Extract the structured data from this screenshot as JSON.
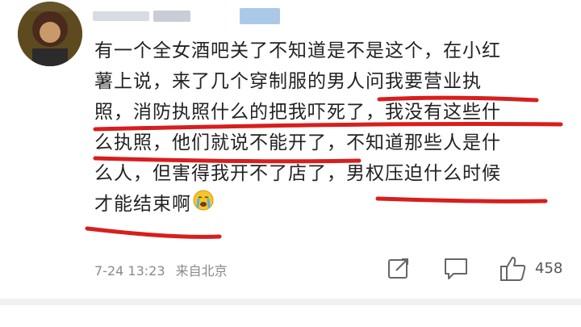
{
  "post": {
    "lines": [
      "有一个全女酒吧关了不知道是不是这个，在小红",
      "薯上说，来了几个穿制服的男人问我要营业执",
      "照，消防执照什么的把我吓死了，我没有这些什",
      "么执照，他们就说不能开了，不知道那些人是什",
      "么人，但害得我开不了店了，男权压迫什么时候",
      "才能结束啊"
    ],
    "emoji": "crying-face-icon"
  },
  "meta": {
    "date": "7-24 13:23",
    "source": "来自北京"
  },
  "actions": {
    "like_count": "458"
  },
  "colors": {
    "text": "#222222",
    "meta": "#8a8a8a",
    "underline": "#d81e1e",
    "username_blur": "#aac9e8"
  },
  "icons": [
    "avatar",
    "share-icon",
    "comment-icon",
    "like-icon",
    "crying-face-icon"
  ]
}
